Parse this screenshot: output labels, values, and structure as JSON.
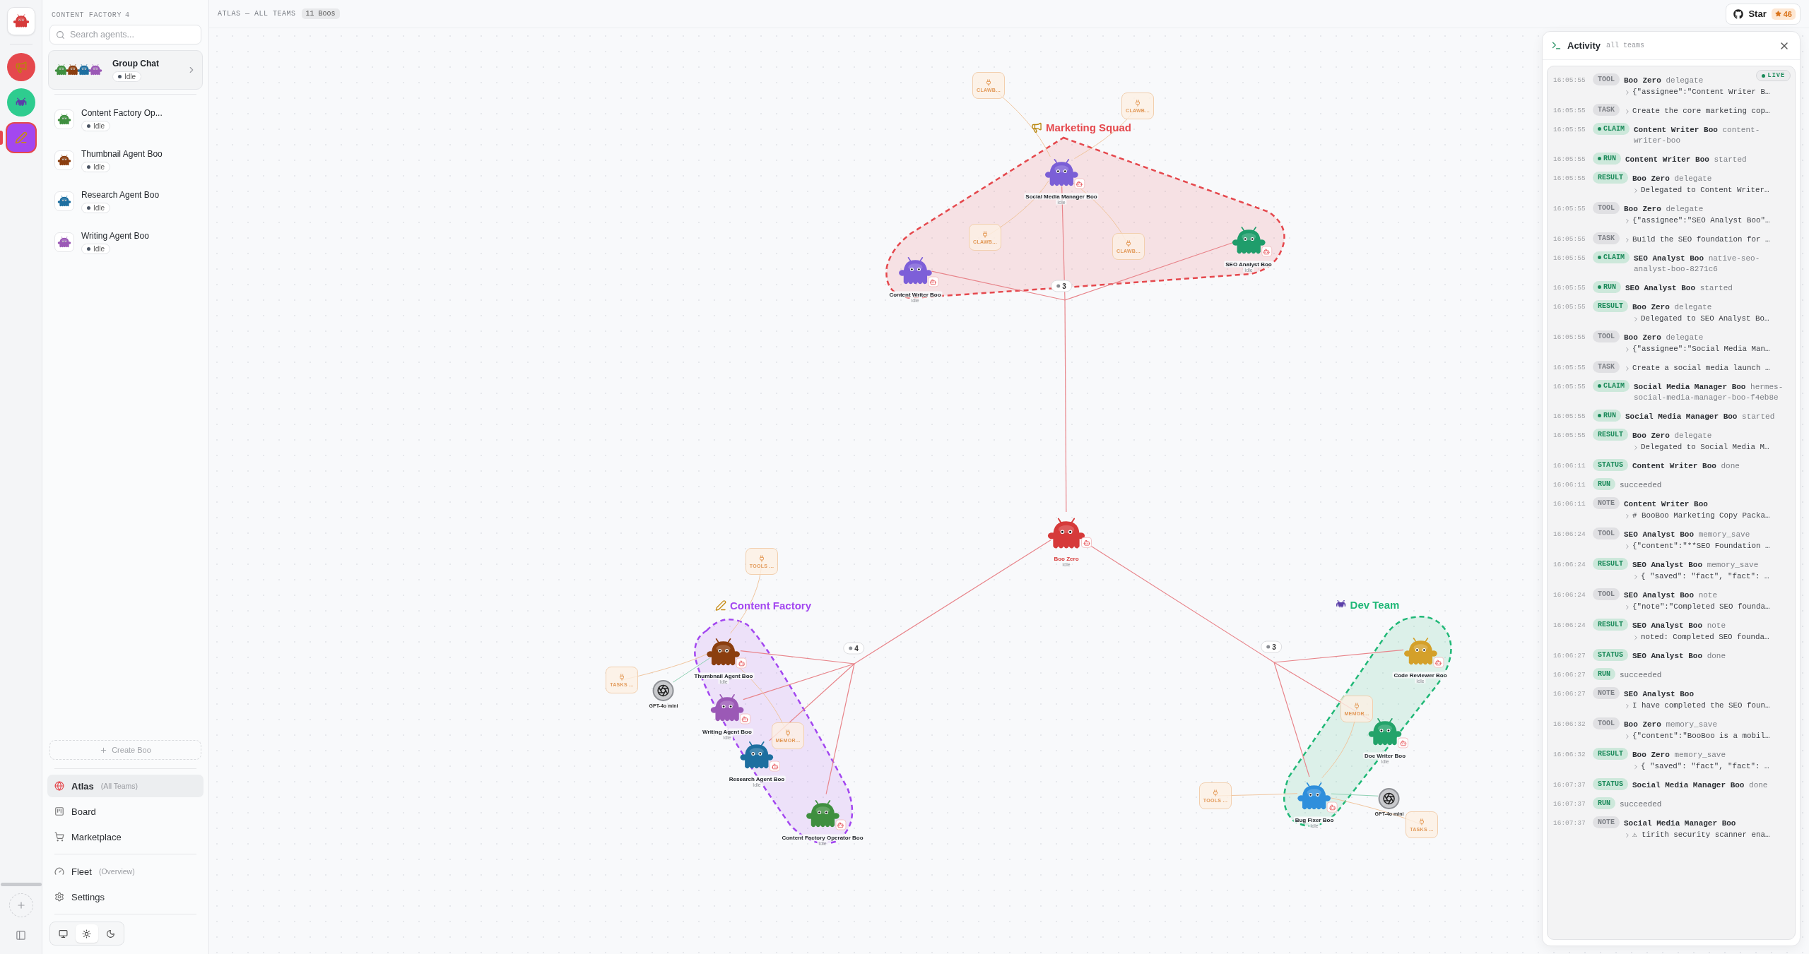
{
  "rail": {
    "teams": [
      {
        "kind": "megaphone",
        "color": "#e5484d",
        "selected": false
      },
      {
        "kind": "invader",
        "color": "#2ecc8f",
        "selected": false
      },
      {
        "kind": "pen",
        "color": "#a347f0",
        "selected": true
      }
    ]
  },
  "sidebar": {
    "title": "CONTENT FACTORY",
    "count": "4",
    "search": {
      "placeholder": "Search agents..."
    },
    "group_chat": {
      "title": "Group Chat",
      "status": "Idle",
      "avatars": [
        {
          "color": "#3f8f3f"
        },
        {
          "color": "#8b3e0f"
        },
        {
          "color": "#1e6fa0"
        },
        {
          "color": "#9b59b6"
        }
      ]
    },
    "agents": [
      {
        "name": "Content Factory Op...",
        "status": "Idle",
        "color": "#3f8f3f"
      },
      {
        "name": "Thumbnail Agent Boo",
        "status": "Idle",
        "color": "#8b3e0f"
      },
      {
        "name": "Research Agent Boo",
        "status": "Idle",
        "color": "#1e6fa0"
      },
      {
        "name": "Writing Agent Boo",
        "status": "Idle",
        "color": "#9b59b6"
      }
    ],
    "create_button": "Create Boo",
    "nav": [
      {
        "kind": "globe",
        "label": "Atlas",
        "hint": "(All Teams)",
        "selected": true
      },
      {
        "kind": "board",
        "label": "Board",
        "selected": false
      },
      {
        "kind": "cart",
        "label": "Marketplace",
        "selected": false
      },
      {
        "kind": "gauge",
        "label": "Fleet",
        "hint": "(Overview)",
        "selected": false
      },
      {
        "kind": "settings",
        "label": "Settings",
        "selected": false
      }
    ],
    "theme": [
      {
        "kind": "monitor",
        "selected": false
      },
      {
        "kind": "sun",
        "selected": true
      },
      {
        "kind": "moon",
        "selected": false
      }
    ]
  },
  "topbar": {
    "title": "ATLAS — ALL TEAMS",
    "count": "11 Boos",
    "star": {
      "label": "Star",
      "count": "46"
    }
  },
  "canvas": {
    "root": {
      "name": "Boo Zero",
      "status": "Idle",
      "color": "#d63a3a"
    },
    "teams": [
      {
        "name": "Marketing Squad",
        "kind": "megaphone",
        "color": "#e5484d",
        "count": "3",
        "members": [
          {
            "name": "Social Media Manager Boo",
            "status": "Idle",
            "color": "#7b5fd6"
          },
          {
            "name": "Content Writer Boo",
            "status": "Idle",
            "color": "#7d5fd8"
          },
          {
            "name": "SEO Analyst Boo",
            "status": "Idle",
            "color": "#1f9d6b"
          }
        ],
        "tools": [
          {
            "label": "CLAWB..."
          },
          {
            "label": "CLAWB..."
          },
          {
            "label": "CLAWB..."
          },
          {
            "label": "CLAWB..."
          }
        ]
      },
      {
        "name": "Content Factory",
        "kind": "pen",
        "color": "#a347f0",
        "count": "4",
        "members": [
          {
            "name": "Thumbnail Agent Boo",
            "status": "Idle",
            "color": "#8b3e0f"
          },
          {
            "name": "Writing Agent Boo",
            "status": "Idle",
            "color": "#9b59b6"
          },
          {
            "name": "Research Agent Boo",
            "status": "Idle",
            "color": "#1e6fa0"
          },
          {
            "name": "Content Factory Operator Boo",
            "status": "Idle",
            "color": "#3f8f3f"
          }
        ],
        "tools": [
          {
            "label": "TOOLS ..."
          },
          {
            "label": "TASKS ..."
          },
          {
            "label": "MEMOR..."
          }
        ],
        "models": [
          {
            "label": "GPT-4o mini"
          }
        ]
      },
      {
        "name": "Dev Team",
        "kind": "invader",
        "color": "#20b877",
        "count": "3",
        "members": [
          {
            "name": "Code Reviewer Boo",
            "status": "Idle",
            "color": "#d4a02a"
          },
          {
            "name": "Doc Writer Boo",
            "status": "Idle",
            "color": "#23a36a"
          },
          {
            "name": "Bug Fixer Boo",
            "status": "Idle",
            "color": "#2f8fdc"
          }
        ],
        "tools": [
          {
            "label": "MEMOR..."
          },
          {
            "label": "TOOLS ..."
          },
          {
            "label": "TASKS ..."
          }
        ],
        "models": [
          {
            "label": "GPT-4o mini"
          }
        ]
      }
    ]
  },
  "activity": {
    "title": "Activity",
    "scope": "all teams",
    "live": "LIVE",
    "entries": [
      {
        "time": "16:05:55",
        "tag": "TOOL",
        "success": false,
        "dot": false,
        "actor": "Boo Zero",
        "action": "delegate",
        "detail": "{\"assignee\":\"Content Writer B…"
      },
      {
        "time": "16:05:55",
        "tag": "TASK",
        "success": false,
        "dot": false,
        "detail": "Create the core marketing cop…"
      },
      {
        "time": "16:05:55",
        "tag": "CLAIM",
        "success": true,
        "dot": true,
        "actor": "Content Writer Boo",
        "action": "content-writer-boo"
      },
      {
        "time": "16:05:55",
        "tag": "RUN",
        "success": true,
        "dot": true,
        "actor": "Content Writer Boo",
        "action": "started"
      },
      {
        "time": "16:05:55",
        "tag": "RESULT",
        "success": true,
        "dot": false,
        "actor": "Boo Zero",
        "action": "delegate",
        "detail": "Delegated to Content Writer…"
      },
      {
        "time": "16:05:55",
        "tag": "TOOL",
        "success": false,
        "dot": false,
        "actor": "Boo Zero",
        "action": "delegate",
        "detail": "{\"assignee\":\"SEO Analyst Boo\"…"
      },
      {
        "time": "16:05:55",
        "tag": "TASK",
        "success": false,
        "dot": false,
        "detail": "Build the SEO foundation for …"
      },
      {
        "time": "16:05:55",
        "tag": "CLAIM",
        "success": true,
        "dot": true,
        "actor": "SEO Analyst Boo",
        "action": "native-seo-analyst-boo-8271c6"
      },
      {
        "time": "16:05:55",
        "tag": "RUN",
        "success": true,
        "dot": true,
        "actor": "SEO Analyst Boo",
        "action": "started"
      },
      {
        "time": "16:05:55",
        "tag": "RESULT",
        "success": true,
        "dot": false,
        "actor": "Boo Zero",
        "action": "delegate",
        "detail": "Delegated to SEO Analyst Bo…"
      },
      {
        "time": "16:05:55",
        "tag": "TOOL",
        "success": false,
        "dot": false,
        "actor": "Boo Zero",
        "action": "delegate",
        "detail": "{\"assignee\":\"Social Media Man…"
      },
      {
        "time": "16:05:55",
        "tag": "TASK",
        "success": false,
        "dot": false,
        "detail": "Create a social media launch …"
      },
      {
        "time": "16:05:55",
        "tag": "CLAIM",
        "success": true,
        "dot": true,
        "actor": "Social Media Manager Boo",
        "action": "hermes-social-media-manager-boo-f4eb8e"
      },
      {
        "time": "16:05:55",
        "tag": "RUN",
        "success": true,
        "dot": true,
        "actor": "Social Media Manager Boo",
        "action": "started"
      },
      {
        "time": "16:05:55",
        "tag": "RESULT",
        "success": true,
        "dot": false,
        "actor": "Boo Zero",
        "action": "delegate",
        "detail": "Delegated to Social Media M…"
      },
      {
        "time": "16:06:11",
        "tag": "STATUS",
        "success": true,
        "dot": false,
        "actor": "Content Writer Boo",
        "action": "done"
      },
      {
        "time": "16:06:11",
        "tag": "RUN",
        "success": true,
        "dot": false,
        "action": "succeeded"
      },
      {
        "time": "16:06:11",
        "tag": "NOTE",
        "success": false,
        "dot": false,
        "actor": "Content Writer Boo",
        "detail": "# BooBoo Marketing Copy Packa…"
      },
      {
        "time": "16:06:24",
        "tag": "TOOL",
        "success": false,
        "dot": false,
        "actor": "SEO Analyst Boo",
        "action": "memory_save",
        "detail": "{\"content\":\"**SEO Foundation …"
      },
      {
        "time": "16:06:24",
        "tag": "RESULT",
        "success": true,
        "dot": false,
        "actor": "SEO Analyst Boo",
        "action": "memory_save",
        "detail": "{ \"saved\": \"fact\", \"fact\": …"
      },
      {
        "time": "16:06:24",
        "tag": "TOOL",
        "success": false,
        "dot": false,
        "actor": "SEO Analyst Boo",
        "action": "note",
        "detail": "{\"note\":\"Completed SEO founda…"
      },
      {
        "time": "16:06:24",
        "tag": "RESULT",
        "success": true,
        "dot": false,
        "actor": "SEO Analyst Boo",
        "action": "note",
        "detail": "noted: Completed SEO founda…"
      },
      {
        "time": "16:06:27",
        "tag": "STATUS",
        "success": true,
        "dot": false,
        "actor": "SEO Analyst Boo",
        "action": "done"
      },
      {
        "time": "16:06:27",
        "tag": "RUN",
        "success": true,
        "dot": false,
        "action": "succeeded"
      },
      {
        "time": "16:06:27",
        "tag": "NOTE",
        "success": false,
        "dot": false,
        "actor": "SEO Analyst Boo",
        "detail": "I have completed the SEO foun…"
      },
      {
        "time": "16:06:32",
        "tag": "TOOL",
        "success": false,
        "dot": false,
        "actor": "Boo Zero",
        "action": "memory_save",
        "detail": "{\"content\":\"BooBoo is a mobil…"
      },
      {
        "time": "16:06:32",
        "tag": "RESULT",
        "success": true,
        "dot": false,
        "actor": "Boo Zero",
        "action": "memory_save",
        "detail": "{ \"saved\": \"fact\", \"fact\": …"
      },
      {
        "time": "16:07:37",
        "tag": "STATUS",
        "success": true,
        "dot": false,
        "actor": "Social Media Manager Boo",
        "action": "done"
      },
      {
        "time": "16:07:37",
        "tag": "RUN",
        "success": true,
        "dot": false,
        "action": "succeeded"
      },
      {
        "time": "16:07:37",
        "tag": "NOTE",
        "success": false,
        "dot": false,
        "actor": "Social Media Manager Boo",
        "detail": "⚠ tirith security scanner ena…"
      }
    ]
  }
}
